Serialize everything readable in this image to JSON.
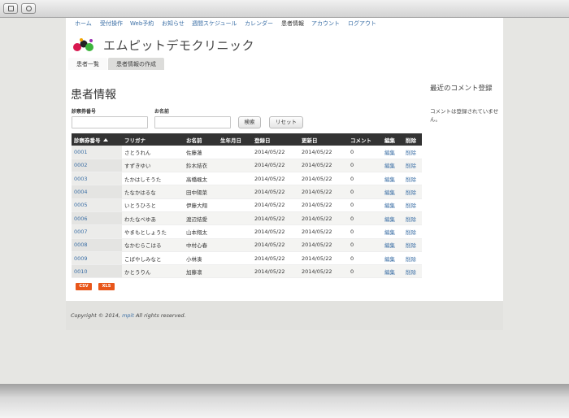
{
  "nav": {
    "items": [
      "ホーム",
      "受付操作",
      "Web予約",
      "お知らせ",
      "週間スケジュール",
      "カレンダー",
      "患者情報",
      "アカウント",
      "ログアウト"
    ]
  },
  "header": {
    "site_name": "エムピットデモクリニック",
    "tabs": [
      "患者一覧",
      "患者情報の作成"
    ]
  },
  "main": {
    "title": "患者情報",
    "search": {
      "card_label": "診察券番号",
      "name_label": "お名前",
      "card_value": "",
      "name_value": "",
      "search_button": "検索",
      "reset_button": "リセット"
    },
    "table": {
      "columns": [
        "診察券番号",
        "フリガナ",
        "お名前",
        "生年月日",
        "登録日",
        "更新日",
        "コメント",
        "編集",
        "削除"
      ],
      "rows": [
        {
          "id": "0001",
          "kana": "さとうれん",
          "name": "佐藤蓮",
          "birth": "",
          "created": "2014/05/22",
          "updated": "2014/05/22",
          "comments": "0",
          "edit": "編集",
          "delete": "削除"
        },
        {
          "id": "0002",
          "kana": "すずきゆい",
          "name": "鈴木結衣",
          "birth": "",
          "created": "2014/05/22",
          "updated": "2014/05/22",
          "comments": "0",
          "edit": "編集",
          "delete": "削除"
        },
        {
          "id": "0003",
          "kana": "たかはしそうた",
          "name": "高橋颯太",
          "birth": "",
          "created": "2014/05/22",
          "updated": "2014/05/22",
          "comments": "0",
          "edit": "編集",
          "delete": "削除"
        },
        {
          "id": "0004",
          "kana": "たなかはるな",
          "name": "田中陽菜",
          "birth": "",
          "created": "2014/05/22",
          "updated": "2014/05/22",
          "comments": "0",
          "edit": "編集",
          "delete": "削除"
        },
        {
          "id": "0005",
          "kana": "いとうひろと",
          "name": "伊藤大翔",
          "birth": "",
          "created": "2014/05/22",
          "updated": "2014/05/22",
          "comments": "0",
          "edit": "編集",
          "delete": "削除"
        },
        {
          "id": "0006",
          "kana": "わたなべゆあ",
          "name": "渡辺結愛",
          "birth": "",
          "created": "2014/05/22",
          "updated": "2014/05/22",
          "comments": "0",
          "edit": "編集",
          "delete": "削除"
        },
        {
          "id": "0007",
          "kana": "やまもとしょうた",
          "name": "山本翔太",
          "birth": "",
          "created": "2014/05/22",
          "updated": "2014/05/22",
          "comments": "0",
          "edit": "編集",
          "delete": "削除"
        },
        {
          "id": "0008",
          "kana": "なかむらこはる",
          "name": "中村心春",
          "birth": "",
          "created": "2014/05/22",
          "updated": "2014/05/22",
          "comments": "0",
          "edit": "編集",
          "delete": "削除"
        },
        {
          "id": "0009",
          "kana": "こばやしみなと",
          "name": "小林湊",
          "birth": "",
          "created": "2014/05/22",
          "updated": "2014/05/22",
          "comments": "0",
          "edit": "編集",
          "delete": "削除"
        },
        {
          "id": "0010",
          "kana": "かとうりん",
          "name": "加藤凛",
          "birth": "",
          "created": "2014/05/22",
          "updated": "2014/05/22",
          "comments": "0",
          "edit": "編集",
          "delete": "削除"
        }
      ]
    },
    "export": {
      "csv": "CSV",
      "xls": "XLS"
    }
  },
  "sidebar": {
    "title": "最近のコメント登録",
    "empty_text": "コメントは登録されていません。"
  },
  "footer": {
    "prefix": "Copyright © 2014,",
    "link": "mpit",
    "suffix": "All rights reserved."
  },
  "colors": {
    "link": "#3a6ea5",
    "table_header": "#333333",
    "export_button": "#e8561a"
  }
}
